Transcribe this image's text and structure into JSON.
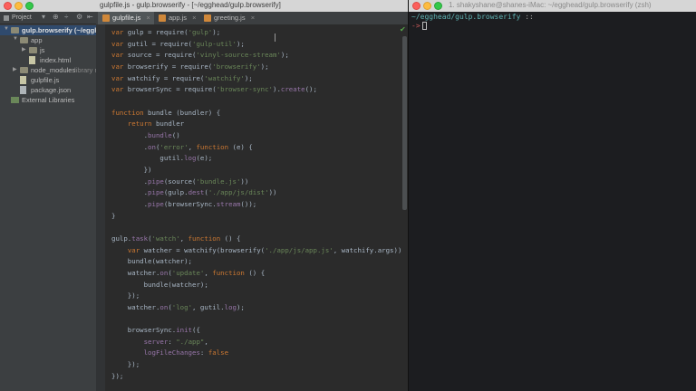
{
  "ide": {
    "title": "gulpfile.js - gulp.browserify - [~/egghead/gulp.browserify]",
    "project_toolbar": {
      "label": "Project"
    },
    "tabs": [
      {
        "label": "gulpfile.js",
        "active": true
      },
      {
        "label": "app.js",
        "active": false
      },
      {
        "label": "greeting.js",
        "active": false
      }
    ],
    "tree": [
      {
        "label": "gulp.browserify (~/egghead/gulp.browserify)",
        "depth": 0,
        "kind": "folder",
        "expanded": true,
        "selected": true
      },
      {
        "label": "app",
        "depth": 1,
        "kind": "folder",
        "expanded": true
      },
      {
        "label": "js",
        "depth": 2,
        "kind": "folder",
        "expanded": false
      },
      {
        "label": "index.html",
        "depth": 2,
        "kind": "file"
      },
      {
        "label": "node_modules",
        "depth": 1,
        "kind": "folder",
        "expanded": false,
        "suffix": "library root"
      },
      {
        "label": "gulpfile.js",
        "depth": 1,
        "kind": "file"
      },
      {
        "label": "package.json",
        "depth": 1,
        "kind": "json"
      },
      {
        "label": "External Libraries",
        "depth": 0,
        "kind": "library"
      }
    ],
    "code": [
      "var gulp = require('gulp');",
      "var gutil = require('gulp-util');",
      "var source = require('vinyl-source-stream');",
      "var browserify = require('browserify');",
      "var watchify = require('watchify');",
      "var browserSync = require('browser-sync').create();",
      "",
      "function bundle (bundler) {",
      "    return bundler",
      "        .bundle()",
      "        .on('error', function (e) {",
      "            gutil.log(e);",
      "        })",
      "        .pipe(source('bundle.js'))",
      "        .pipe(gulp.dest('./app/js/dist'))",
      "        .pipe(browserSync.stream());",
      "}",
      "",
      "gulp.task('watch', function () {",
      "    var watcher = watchify(browserify('./app/js/app.js', watchify.args));",
      "    bundle(watcher);",
      "    watcher.on('update', function () {",
      "        bundle(watcher);",
      "    });",
      "    watcher.on('log', gutil.log);",
      "",
      "    browserSync.init({",
      "        server: \"./app\",",
      "        logFileChanges: false",
      "    });",
      "});"
    ]
  },
  "terminal": {
    "title": "1. shakyshane@shanes-iMac: ~/egghead/gulp.browserify (zsh)",
    "path": "~/egghead/gulp.browserify",
    "path_suffix": " ::",
    "prompt": "->"
  },
  "colors": {
    "keyword": "#cc7832",
    "string": "#6a8759",
    "function": "#ffc66d",
    "property": "#9876aa",
    "text": "#a9b7c6",
    "terminal_path": "#5fb3b3",
    "terminal_prompt": "#c85959"
  },
  "icons": {
    "close": "close-icon",
    "check": "check-icon",
    "folder": "folder-icon",
    "file": "file-icon"
  }
}
